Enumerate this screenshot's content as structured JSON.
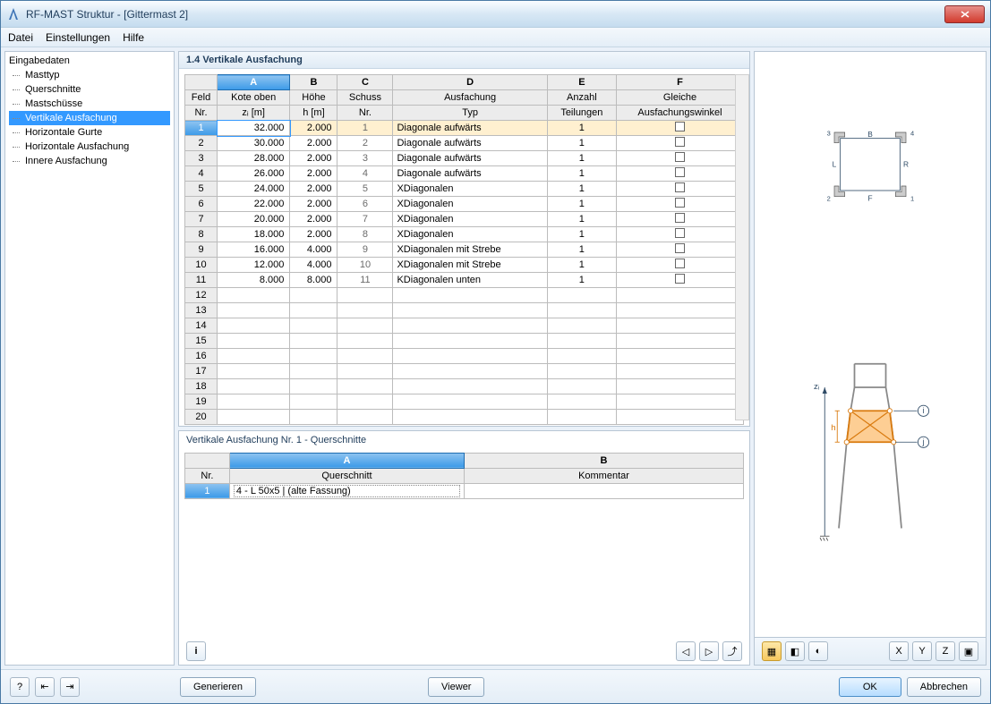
{
  "window": {
    "title": "RF-MAST Struktur - [Gittermast 2]"
  },
  "menu": {
    "file": "Datei",
    "settings": "Einstellungen",
    "help": "Hilfe"
  },
  "sidebar": {
    "root": "Eingabedaten",
    "items": [
      {
        "label": "Masttyp"
      },
      {
        "label": "Querschnitte"
      },
      {
        "label": "Mastschüsse"
      },
      {
        "label": "Vertikale Ausfachung",
        "selected": true
      },
      {
        "label": "Horizontale Gurte"
      },
      {
        "label": "Horizontale Ausfachung"
      },
      {
        "label": "Innere Ausfachung"
      }
    ]
  },
  "panel_title": "1.4 Vertikale Ausfachung",
  "grid": {
    "col_letters": [
      "A",
      "B",
      "C",
      "D",
      "E",
      "F"
    ],
    "headers_r1": [
      "Feld",
      "Kote oben",
      "Höhe",
      "Schuss",
      "Ausfachung",
      "Anzahl",
      "Gleiche"
    ],
    "headers_r2": [
      "Nr.",
      "zᵢ [m]",
      "h [m]",
      "Nr.",
      "Typ",
      "Teilungen",
      "Ausfachungswinkel"
    ],
    "rows": [
      {
        "n": 1,
        "zi": "32.000",
        "h": "2.000",
        "s": 1,
        "typ": "Diagonale aufwärts",
        "t": 1
      },
      {
        "n": 2,
        "zi": "30.000",
        "h": "2.000",
        "s": 2,
        "typ": "Diagonale aufwärts",
        "t": 1
      },
      {
        "n": 3,
        "zi": "28.000",
        "h": "2.000",
        "s": 3,
        "typ": "Diagonale aufwärts",
        "t": 1
      },
      {
        "n": 4,
        "zi": "26.000",
        "h": "2.000",
        "s": 4,
        "typ": "Diagonale aufwärts",
        "t": 1
      },
      {
        "n": 5,
        "zi": "24.000",
        "h": "2.000",
        "s": 5,
        "typ": "XDiagonalen",
        "t": 1
      },
      {
        "n": 6,
        "zi": "22.000",
        "h": "2.000",
        "s": 6,
        "typ": "XDiagonalen",
        "t": 1
      },
      {
        "n": 7,
        "zi": "20.000",
        "h": "2.000",
        "s": 7,
        "typ": "XDiagonalen",
        "t": 1
      },
      {
        "n": 8,
        "zi": "18.000",
        "h": "2.000",
        "s": 8,
        "typ": "XDiagonalen",
        "t": 1
      },
      {
        "n": 9,
        "zi": "16.000",
        "h": "4.000",
        "s": 9,
        "typ": "XDiagonalen mit Strebe",
        "t": 1
      },
      {
        "n": 10,
        "zi": "12.000",
        "h": "4.000",
        "s": 10,
        "typ": "XDiagonalen mit Strebe",
        "t": 1
      },
      {
        "n": 11,
        "zi": "8.000",
        "h": "8.000",
        "s": 11,
        "typ": "KDiagonalen unten",
        "t": 1
      }
    ],
    "empty_rows": [
      12,
      13,
      14,
      15,
      16,
      17,
      18,
      19,
      20
    ]
  },
  "subgrid": {
    "title": "Vertikale Ausfachung Nr. 1  -  Querschnitte",
    "col_letters": [
      "A",
      "B"
    ],
    "headers": [
      "Nr.",
      "Querschnitt",
      "Kommentar"
    ],
    "rows": [
      {
        "n": 1,
        "q": "4 - L 50x5 | (alte Fassung)",
        "k": ""
      }
    ]
  },
  "diagram": {
    "labels": {
      "B": "B",
      "F": "F",
      "L": "L",
      "R": "R"
    },
    "corners": {
      "c1": "1",
      "c2": "2",
      "c3": "3",
      "c4": "4"
    },
    "zi": "zᵢ",
    "h": "h",
    "i": "i",
    "j": "j"
  },
  "buttons": {
    "generate": "Generieren",
    "viewer": "Viewer",
    "ok": "OK",
    "cancel": "Abbrechen"
  }
}
